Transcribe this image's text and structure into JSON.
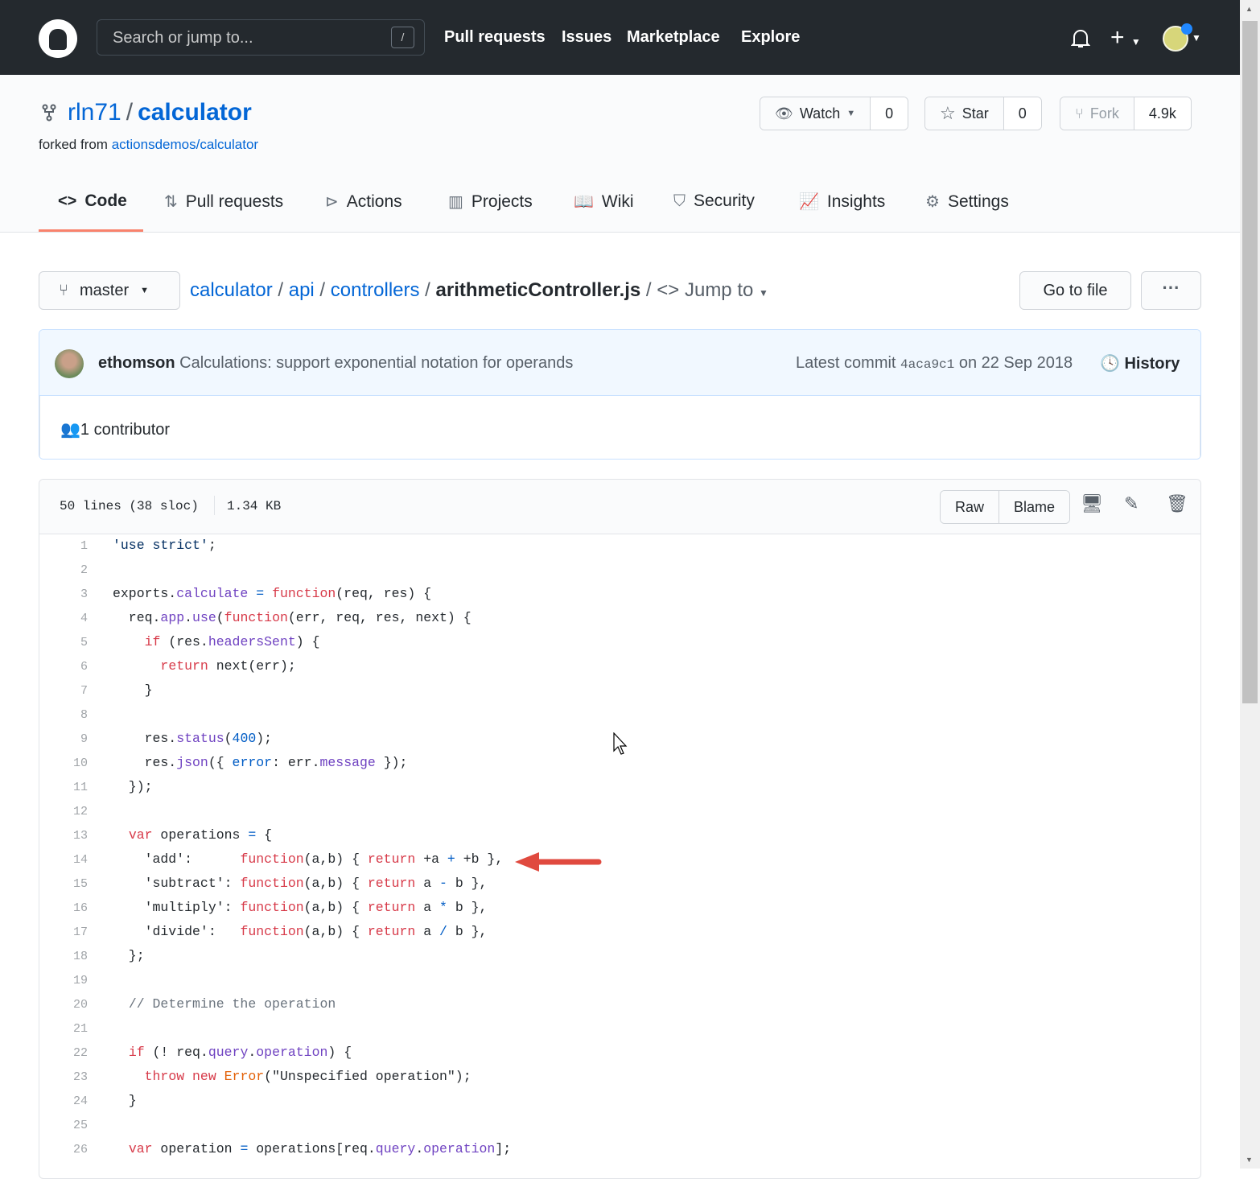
{
  "header": {
    "search_placeholder": "Search or jump to...",
    "slash_key": "/",
    "nav": [
      "Pull requests",
      "Issues",
      "Marketplace",
      "Explore"
    ]
  },
  "repo": {
    "owner": "rln71",
    "separator": "/",
    "name": "calculator",
    "forked_label": "forked from",
    "forked_link": "actionsdemos/calculator",
    "watch": {
      "label": "Watch",
      "count": "0"
    },
    "star": {
      "label": "Star",
      "count": "0"
    },
    "fork": {
      "label": "Fork",
      "count": "4.9k"
    }
  },
  "tabs": [
    {
      "label": "Code",
      "icon": "code-icon"
    },
    {
      "label": "Pull requests",
      "icon": "pull-request-icon"
    },
    {
      "label": "Actions",
      "icon": "play-icon"
    },
    {
      "label": "Projects",
      "icon": "project-icon"
    },
    {
      "label": "Wiki",
      "icon": "book-icon"
    },
    {
      "label": "Security",
      "icon": "shield-icon"
    },
    {
      "label": "Insights",
      "icon": "graph-icon"
    },
    {
      "label": "Settings",
      "icon": "gear-icon"
    }
  ],
  "branch": "master",
  "breadcrumb": {
    "parts": [
      "calculator",
      "api",
      "controllers"
    ],
    "file": "arithmeticController.js",
    "jump": "Jump to"
  },
  "go_to_file": "Go to file",
  "commit": {
    "author": "ethomson",
    "message": "Calculations: support exponential notation for operands",
    "latest_label": "Latest commit",
    "sha": "4aca9c1",
    "date": "on 22 Sep 2018",
    "history": "History"
  },
  "contributors": "1 contributor",
  "file": {
    "lines_info": "50 lines (38 sloc)",
    "size": "1.34 KB",
    "raw": "Raw",
    "blame": "Blame"
  },
  "colors": {
    "keyword": "#d73a49",
    "entity": "#6f42c1",
    "constant": "#005cc5",
    "accent_tab": "#f9826c",
    "link": "#0366d6",
    "annotation_arrow": "#e04a3f"
  },
  "code": [
    [
      [
        "'use strict'",
        "s"
      ],
      [
        ";",
        ""
      ]
    ],
    [],
    [
      [
        "exports.",
        ""
      ],
      [
        "calculate",
        "f"
      ],
      [
        " ",
        ""
      ],
      [
        "=",
        "c"
      ],
      [
        " ",
        ""
      ],
      [
        "function",
        "k"
      ],
      [
        "(req, res) {",
        ""
      ]
    ],
    [
      [
        "  req.",
        ""
      ],
      [
        "app",
        "f"
      ],
      [
        ".",
        ""
      ],
      [
        "use",
        "f"
      ],
      [
        "(",
        ""
      ],
      [
        "function",
        "k"
      ],
      [
        "(err, req, res, next) {",
        ""
      ]
    ],
    [
      [
        "    ",
        ""
      ],
      [
        "if",
        "k"
      ],
      [
        " (res.",
        ""
      ],
      [
        "headersSent",
        "f"
      ],
      [
        ") {",
        ""
      ]
    ],
    [
      [
        "      ",
        ""
      ],
      [
        "return",
        "k"
      ],
      [
        " next(err);",
        ""
      ]
    ],
    [
      [
        "    }",
        ""
      ]
    ],
    [],
    [
      [
        "    res.",
        ""
      ],
      [
        "status",
        "f"
      ],
      [
        "(",
        ""
      ],
      [
        "400",
        "c"
      ],
      [
        ");",
        ""
      ]
    ],
    [
      [
        "    res.",
        ""
      ],
      [
        "json",
        "f"
      ],
      [
        "({ ",
        ""
      ],
      [
        "error",
        "c"
      ],
      [
        ": err.",
        ""
      ],
      [
        "message",
        "f"
      ],
      [
        " });",
        ""
      ]
    ],
    [
      [
        "  });",
        ""
      ]
    ],
    [],
    [
      [
        "  ",
        ""
      ],
      [
        "var",
        "k"
      ],
      [
        " operations ",
        ""
      ],
      [
        "=",
        "c"
      ],
      [
        " {",
        ""
      ]
    ],
    [
      [
        "    'add':      ",
        ""
      ],
      [
        "function",
        "k"
      ],
      [
        "(a,b) { ",
        ""
      ],
      [
        "return",
        "k"
      ],
      [
        " +a ",
        ""
      ],
      [
        "+",
        "c"
      ],
      [
        " +b },",
        ""
      ]
    ],
    [
      [
        "    'subtract': ",
        ""
      ],
      [
        "function",
        "k"
      ],
      [
        "(a,b) { ",
        ""
      ],
      [
        "return",
        "k"
      ],
      [
        " a ",
        ""
      ],
      [
        "-",
        "c"
      ],
      [
        " b },",
        ""
      ]
    ],
    [
      [
        "    'multiply': ",
        ""
      ],
      [
        "function",
        "k"
      ],
      [
        "(a,b) { ",
        ""
      ],
      [
        "return",
        "k"
      ],
      [
        " a ",
        ""
      ],
      [
        "*",
        "c"
      ],
      [
        " b },",
        ""
      ]
    ],
    [
      [
        "    'divide':   ",
        ""
      ],
      [
        "function",
        "k"
      ],
      [
        "(a,b) { ",
        ""
      ],
      [
        "return",
        "k"
      ],
      [
        " a ",
        ""
      ],
      [
        "/",
        "c"
      ],
      [
        " b },",
        ""
      ]
    ],
    [
      [
        "  };",
        ""
      ]
    ],
    [],
    [
      [
        "  ",
        ""
      ],
      [
        "// Determine the operation",
        "cm"
      ]
    ],
    [],
    [
      [
        "  ",
        ""
      ],
      [
        "if",
        "k"
      ],
      [
        " (! req.",
        ""
      ],
      [
        "query",
        "f"
      ],
      [
        ".",
        ""
      ],
      [
        "operation",
        "f"
      ],
      [
        ") {",
        ""
      ]
    ],
    [
      [
        "    ",
        ""
      ],
      [
        "throw",
        "k"
      ],
      [
        " ",
        ""
      ],
      [
        "new",
        "k"
      ],
      [
        " ",
        ""
      ],
      [
        "Error",
        "o"
      ],
      [
        "(\"Unspecified operation\");",
        ""
      ]
    ],
    [
      [
        "  }",
        ""
      ]
    ],
    [],
    [
      [
        "  ",
        ""
      ],
      [
        "var",
        "k"
      ],
      [
        " operation ",
        ""
      ],
      [
        "=",
        "c"
      ],
      [
        " operations[req.",
        ""
      ],
      [
        "query",
        "f"
      ],
      [
        ".",
        ""
      ],
      [
        "operation",
        "f"
      ],
      [
        "];",
        ""
      ]
    ]
  ]
}
